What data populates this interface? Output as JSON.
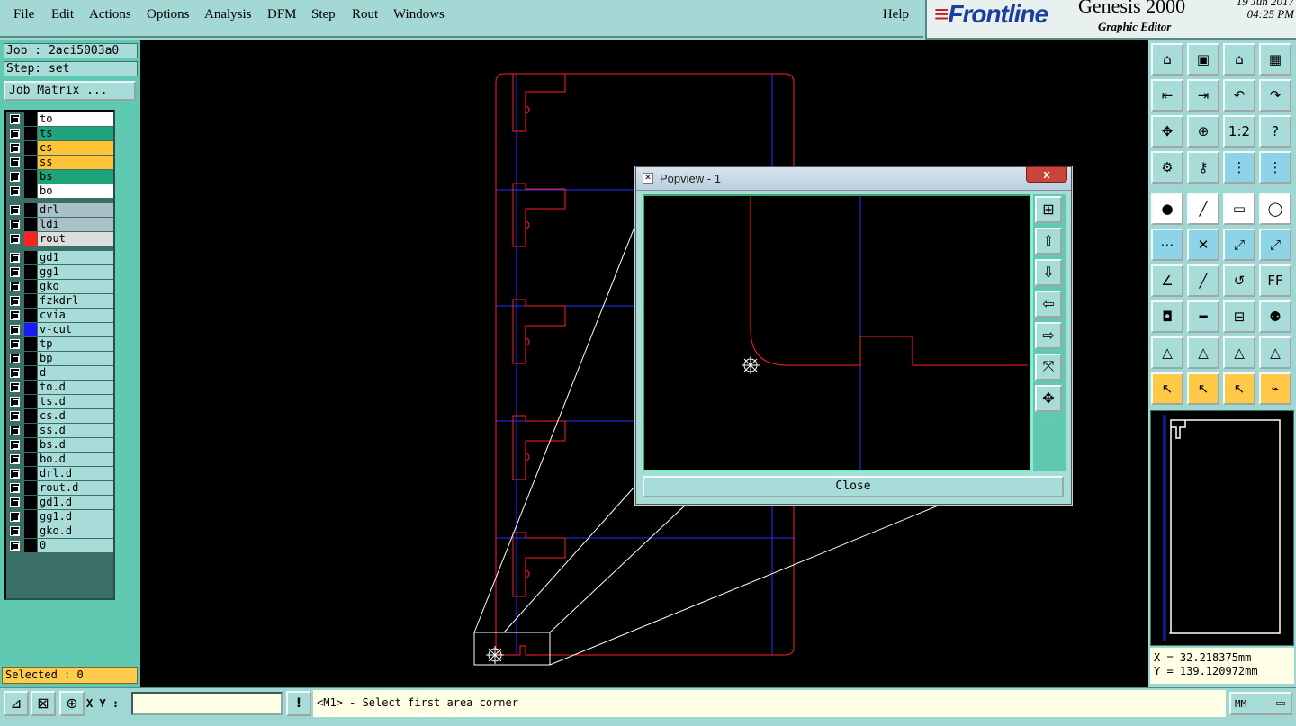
{
  "menu": [
    "File",
    "Edit",
    "Actions",
    "Options",
    "Analysis",
    "DFM",
    "Step",
    "Rout",
    "Windows"
  ],
  "help": "Help",
  "brand": {
    "logo": "Frontline",
    "app": "Genesis 2000",
    "editor": "Graphic Editor",
    "date": "19 Jun 2017",
    "time": "04:25 PM"
  },
  "job": {
    "label": "Job : 2aci5003a0",
    "step": "Step: set",
    "matrix_button": "Job Matrix ..."
  },
  "layers": [
    {
      "name": "to",
      "color": "#ffffff",
      "swatch": "#000000"
    },
    {
      "name": "ts",
      "color": "#1fa37a",
      "swatch": "#000000"
    },
    {
      "name": "cs",
      "color": "#ffc338",
      "swatch": "#000000"
    },
    {
      "name": "ss",
      "color": "#ffc338",
      "swatch": "#000000"
    },
    {
      "name": "bs",
      "color": "#1fa37a",
      "swatch": "#000000"
    },
    {
      "name": "bo",
      "color": "#ffffff",
      "swatch": "#000000"
    },
    {
      "name": "drl",
      "color": "#a8c0c6",
      "swatch": "#000000"
    },
    {
      "name": "ldi",
      "color": "#a8c0c6",
      "swatch": "#000000"
    },
    {
      "name": "rout",
      "color": "#dcdcdc",
      "swatch": "#ff2020"
    },
    {
      "name": "gd1",
      "color": "#a8dcd8",
      "swatch": "#000000"
    },
    {
      "name": "gg1",
      "color": "#a8dcd8",
      "swatch": "#000000"
    },
    {
      "name": "gko",
      "color": "#a8dcd8",
      "swatch": "#000000"
    },
    {
      "name": "fzkdrl",
      "color": "#a8dcd8",
      "swatch": "#000000"
    },
    {
      "name": "cvia",
      "color": "#a8dcd8",
      "swatch": "#000000"
    },
    {
      "name": "v-cut",
      "color": "#a8dcd8",
      "swatch": "#1a1aff"
    },
    {
      "name": "tp",
      "color": "#a8dcd8",
      "swatch": "#000000"
    },
    {
      "name": "bp",
      "color": "#a8dcd8",
      "swatch": "#000000"
    },
    {
      "name": "d",
      "color": "#a8dcd8",
      "swatch": "#000000"
    },
    {
      "name": "to.d",
      "color": "#a8dcd8",
      "swatch": "#000000"
    },
    {
      "name": "ts.d",
      "color": "#a8dcd8",
      "swatch": "#000000"
    },
    {
      "name": "cs.d",
      "color": "#a8dcd8",
      "swatch": "#000000"
    },
    {
      "name": "ss.d",
      "color": "#a8dcd8",
      "swatch": "#000000"
    },
    {
      "name": "bs.d",
      "color": "#a8dcd8",
      "swatch": "#000000"
    },
    {
      "name": "bo.d",
      "color": "#a8dcd8",
      "swatch": "#000000"
    },
    {
      "name": "drl.d",
      "color": "#a8dcd8",
      "swatch": "#000000"
    },
    {
      "name": "rout.d",
      "color": "#a8dcd8",
      "swatch": "#000000"
    },
    {
      "name": "gd1.d",
      "color": "#a8dcd8",
      "swatch": "#000000"
    },
    {
      "name": "gg1.d",
      "color": "#a8dcd8",
      "swatch": "#000000"
    },
    {
      "name": "gko.d",
      "color": "#a8dcd8",
      "swatch": "#000000"
    },
    {
      "name": "0",
      "color": "#a8dcd8",
      "swatch": "#000000"
    }
  ],
  "selected": "Selected : 0",
  "popview": {
    "title": "Popview - 1",
    "close_label": "Close",
    "close_x": "x"
  },
  "coords": {
    "x": "X = 32.218375mm",
    "y": "Y = 139.120972mm"
  },
  "bottom": {
    "xy_label": "X Y :",
    "xy_value": "",
    "status": "<M1> - Select first area corner",
    "unit": "MM",
    "info_icon": "!"
  },
  "colors": {
    "rout": "#ff2020",
    "vcut": "#2233ff",
    "accent": "#5fc9b2"
  }
}
